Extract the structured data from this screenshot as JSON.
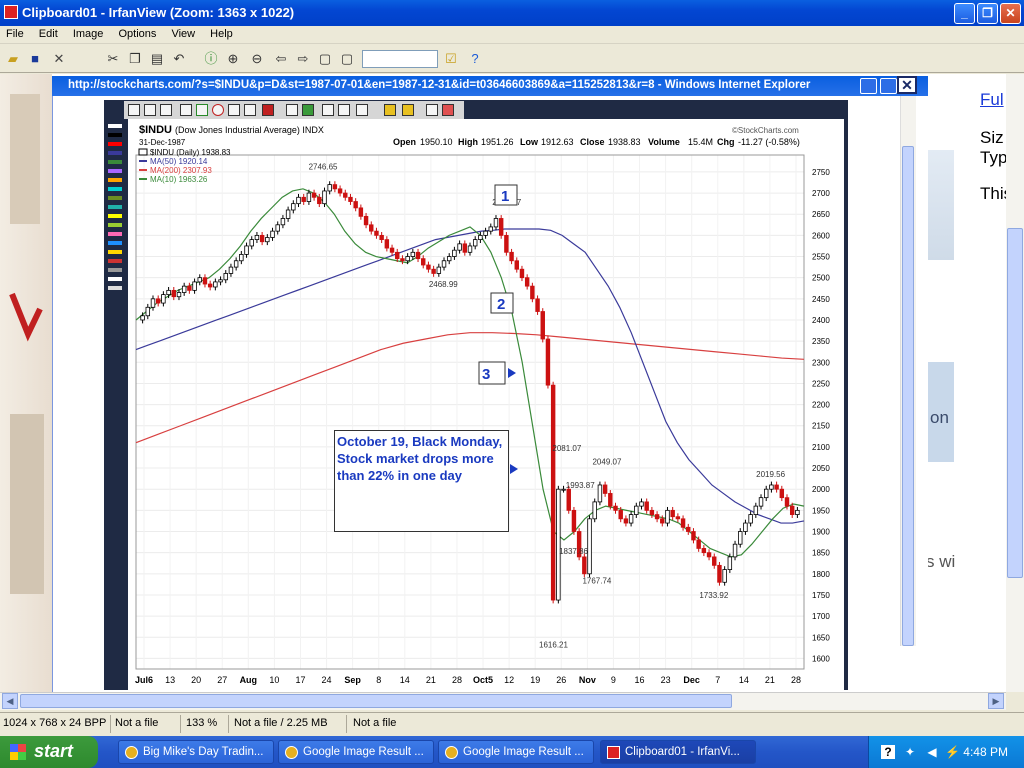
{
  "window": {
    "title": "Clipboard01 - IrfanView (Zoom: 1363 x 1022)",
    "min": "_",
    "max": "❐",
    "close": "✕"
  },
  "menu": [
    "File",
    "Edit",
    "Image",
    "Options",
    "View",
    "Help"
  ],
  "toolbar_icons": [
    "open-icon",
    "save-icon",
    "delete-icon",
    "cut-icon",
    "copy-icon",
    "paste-icon",
    "undo-icon",
    "info-icon",
    "zoom-in-icon",
    "zoom-out-icon",
    "prev-icon",
    "next-icon",
    "first-icon",
    "last-icon",
    "settings-icon",
    "help-icon"
  ],
  "browser": {
    "title": "http://stockcharts.com/?s=$INDU&p=D&st=1987-07-01&en=1987-12-31&id=t03646603869&a=115252813&r=8 - Windows Internet Explorer"
  },
  "right_panel": {
    "link": "Ful",
    "line1": "Siz",
    "line2": "Typ",
    "line3": "This",
    "frag1": "on",
    "frag2": "s wi"
  },
  "chart_data": {
    "type": "candlestick",
    "symbol": "$INDU",
    "name": "(Dow Jones Industrial Average) INDX",
    "date": "31-Dec-1987",
    "source": "©StockCharts.com",
    "quote": {
      "open_label": "Open",
      "open": "1950.10",
      "high_label": "High",
      "high": "1951.26",
      "low_label": "Low",
      "low": "1912.63",
      "close_label": "Close",
      "close": "1938.83",
      "volume_label": "Volume",
      "volume": "15.4M",
      "chg_label": "Chg",
      "chg": "-11.27 (-0.58%)"
    },
    "legend": [
      {
        "label": "$INDU (Daily) 1938.83",
        "color": "#000000"
      },
      {
        "label": "MA(50) 1920.14",
        "color": "#3a3a9a"
      },
      {
        "label": "MA(200) 2307.93",
        "color": "#d84040"
      },
      {
        "label": "MA(10) 1963.26",
        "color": "#3a8a3a"
      }
    ],
    "ylim": [
      1575,
      2790
    ],
    "y_ticks": [
      1600,
      1650,
      1700,
      1750,
      1800,
      1850,
      1900,
      1950,
      2000,
      2050,
      2100,
      2150,
      2200,
      2250,
      2300,
      2350,
      2400,
      2450,
      2500,
      2550,
      2600,
      2650,
      2700,
      2750
    ],
    "x_labels": [
      "Jul6",
      "13",
      "20",
      "27",
      "Aug",
      "10",
      "17",
      "24",
      "Sep",
      "8",
      "14",
      "21",
      "28",
      "Oct5",
      "12",
      "19",
      "26",
      "Nov",
      "9",
      "16",
      "23",
      "Dec",
      "7",
      "14",
      "21",
      "28"
    ],
    "closes": [
      2410,
      2430,
      2450,
      2440,
      2460,
      2470,
      2455,
      2465,
      2480,
      2470,
      2490,
      2500,
      2485,
      2478,
      2490,
      2495,
      2510,
      2525,
      2540,
      2555,
      2575,
      2590,
      2600,
      2585,
      2595,
      2610,
      2625,
      2640,
      2660,
      2675,
      2690,
      2680,
      2700,
      2690,
      2675,
      2705,
      2720,
      2710,
      2700,
      2690,
      2680,
      2665,
      2645,
      2625,
      2610,
      2600,
      2590,
      2570,
      2560,
      2545,
      2540,
      2550,
      2560,
      2545,
      2530,
      2520,
      2510,
      2525,
      2540,
      2550,
      2565,
      2580,
      2560,
      2575,
      2590,
      2600,
      2610,
      2620,
      2640,
      2600,
      2560,
      2540,
      2520,
      2500,
      2480,
      2450,
      2420,
      2355,
      2246,
      1738,
      2000,
      2000,
      1950,
      1900,
      1840,
      1800,
      1930,
      1970,
      2010,
      1990,
      1960,
      1950,
      1930,
      1920,
      1940,
      1960,
      1970,
      1950,
      1940,
      1930,
      1920,
      1950,
      1935,
      1930,
      1910,
      1900,
      1880,
      1860,
      1850,
      1840,
      1820,
      1780,
      1810,
      1840,
      1870,
      1900,
      1920,
      1940,
      1960,
      1980,
      2000,
      2010,
      2000,
      1980,
      1960,
      1940,
      1950
    ],
    "ma50": [
      2330,
      2340,
      2350,
      2360,
      2370,
      2380,
      2390,
      2400,
      2410,
      2420,
      2430,
      2440,
      2450,
      2460,
      2470,
      2480,
      2490,
      2500,
      2510,
      2520,
      2530,
      2540,
      2550,
      2560,
      2570,
      2580,
      2590,
      2595,
      2600,
      2605,
      2610,
      2612,
      2615,
      2615,
      2615,
      2615,
      2612,
      2600,
      2580,
      2560,
      2520,
      2480,
      2430,
      2370,
      2300,
      2230,
      2160,
      2110,
      2070,
      2040,
      2010,
      1990,
      1970,
      1955,
      1940,
      1930,
      1920,
      1920,
      1925
    ],
    "ma200": [
      2110,
      2130,
      2150,
      2170,
      2190,
      2210,
      2230,
      2250,
      2270,
      2290,
      2310,
      2330,
      2345,
      2355,
      2365,
      2370,
      2370,
      2368,
      2365,
      2360,
      2355,
      2350,
      2345,
      2340,
      2335,
      2330,
      2325,
      2320,
      2315,
      2310,
      2307
    ],
    "ma10": [
      2400,
      2420,
      2440,
      2455,
      2470,
      2480,
      2490,
      2500,
      2520,
      2545,
      2575,
      2610,
      2640,
      2665,
      2690,
      2705,
      2710,
      2700,
      2680,
      2650,
      2610,
      2580,
      2560,
      2550,
      2545,
      2540,
      2535,
      2550,
      2570,
      2585,
      2600,
      2610,
      2620,
      2600,
      2560,
      2500,
      2420,
      2300,
      2150,
      2000,
      1900,
      1880,
      1900,
      1930,
      1950,
      1960,
      1955,
      1950,
      1945,
      1940,
      1935,
      1930,
      1920,
      1900,
      1880,
      1860,
      1850,
      1840,
      1845,
      1870,
      1900,
      1930,
      1955,
      1965,
      1960
    ],
    "annotations": [
      {
        "label": "2746.65",
        "x": 0.28,
        "y": 2746.65
      },
      {
        "label": "2662.37",
        "x": 0.555,
        "y": 2662.37
      },
      {
        "label": "2468.99",
        "x": 0.46,
        "y": 2468.99
      },
      {
        "label": "2081.07",
        "x": 0.645,
        "y": 2081.07
      },
      {
        "label": "2049.07",
        "x": 0.705,
        "y": 2049.07
      },
      {
        "label": "1993.87",
        "x": 0.665,
        "y": 1993.87
      },
      {
        "label": "1837.86",
        "x": 0.655,
        "y": 1837.86
      },
      {
        "label": "1767.74",
        "x": 0.69,
        "y": 1767.74
      },
      {
        "label": "1616.21",
        "x": 0.625,
        "y": 1616.21
      },
      {
        "label": "1733.92",
        "x": 0.865,
        "y": 1733.92
      },
      {
        "label": "2019.56",
        "x": 0.95,
        "y": 2019.56
      }
    ],
    "callouts": [
      {
        "label": "1"
      },
      {
        "label": "2"
      },
      {
        "label": "3"
      }
    ],
    "note": "October 19, Black Monday, Stock market drops more than 22% in one day"
  },
  "status": {
    "dims": "1024 x 768 x 24 BPP",
    "file": "Not a file",
    "zoom": "133 %",
    "size": "Not a file / 2.25 MB",
    "extra": "Not a file"
  },
  "taskbar": {
    "start": "start",
    "tasks": [
      {
        "label": "Big Mike's Day Tradin...",
        "active": false
      },
      {
        "label": "Google Image Result ...",
        "active": false
      },
      {
        "label": "Google Image Result ...",
        "active": false
      },
      {
        "label": "Clipboard01 - IrfanVi...",
        "active": true
      }
    ],
    "clock": "4:48 PM"
  },
  "colors": {
    "xp_blue": "#0346d2",
    "chart_frame": "#1f2a44",
    "ma50": "#3a3a9a",
    "ma200": "#d84040",
    "ma10": "#3a8a3a",
    "down": "#cc1111",
    "note_text": "#1a3ac0"
  }
}
